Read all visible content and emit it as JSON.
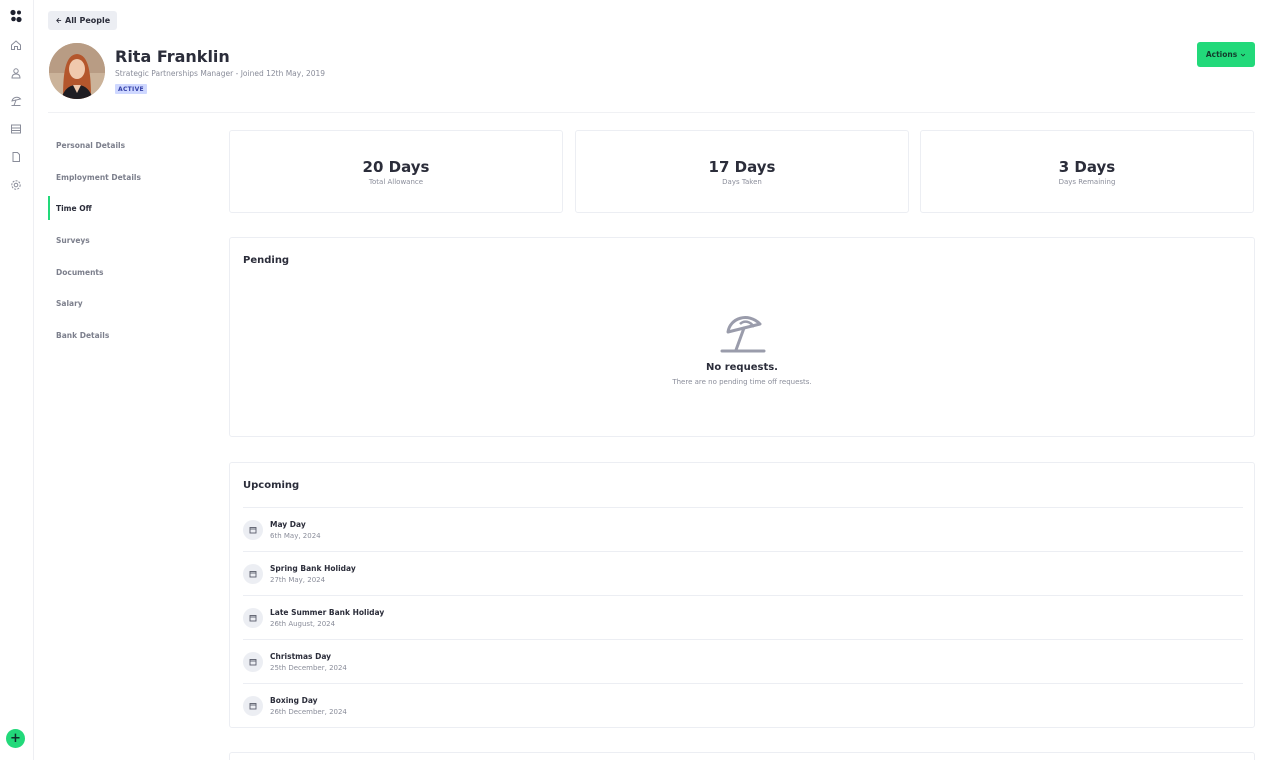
{
  "header": {
    "back_label": "All People",
    "name": "Rita Franklin",
    "subtitle": "Strategic Partnerships Manager - Joined 12th May, 2019",
    "status": "ACTIVE",
    "actions_label": "Actions"
  },
  "rail": {
    "icons": [
      "home-icon",
      "person-icon",
      "beach-icon",
      "table-icon",
      "document-icon",
      "settings-icon"
    ],
    "add_label": "+"
  },
  "nav": {
    "items": [
      {
        "label": "Personal Details"
      },
      {
        "label": "Employment Details"
      },
      {
        "label": "Time Off"
      },
      {
        "label": "Surveys"
      },
      {
        "label": "Documents"
      },
      {
        "label": "Salary"
      },
      {
        "label": "Bank Details"
      }
    ],
    "active": "Time Off"
  },
  "stats": [
    {
      "value": "20 Days",
      "label": "Total Allowance"
    },
    {
      "value": "17 Days",
      "label": "Days Taken"
    },
    {
      "value": "3 Days",
      "label": "Days Remaining"
    }
  ],
  "pending": {
    "title": "Pending",
    "empty_title": "No requests.",
    "empty_text": "There are no pending time off requests."
  },
  "upcoming": {
    "title": "Upcoming",
    "items": [
      {
        "name": "May Day",
        "date": "6th May, 2024"
      },
      {
        "name": "Spring Bank Holiday",
        "date": "27th May, 2024"
      },
      {
        "name": "Late Summer Bank Holiday",
        "date": "26th August, 2024"
      },
      {
        "name": "Christmas Day",
        "date": "25th December, 2024"
      },
      {
        "name": "Boxing Day",
        "date": "26th December, 2024"
      }
    ]
  },
  "colors": {
    "accent": "#22d97a",
    "badge_bg": "#cfd8ff",
    "badge_text": "#3441a8",
    "text": "#2b2d3a",
    "muted": "#8a8d9a"
  }
}
